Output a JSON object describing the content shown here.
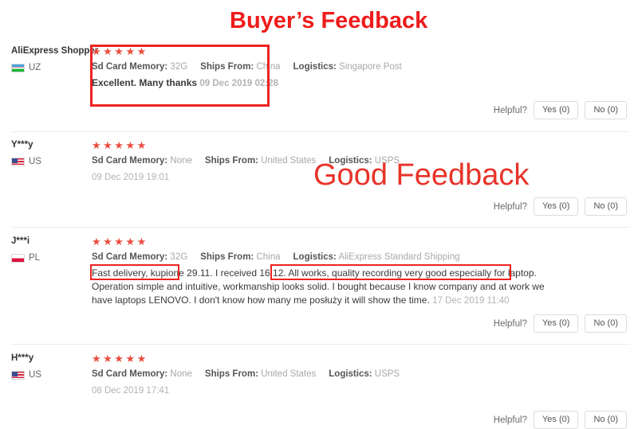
{
  "annotations": {
    "title": "Buyer’s Feedback",
    "subtitle": "Good Feedback",
    "title_color": "#ef1b1b",
    "subtitle_color": "#e8332a",
    "highlight_color": "#ee2222"
  },
  "labels": {
    "sd_card_memory": "Sd Card Memory:",
    "ships_from": "Ships From:",
    "logistics": "Logistics:",
    "helpful": "Helpful?",
    "yes_button": "Yes (0)",
    "no_button": "No (0)",
    "stars": "★★★★★"
  },
  "reviews": [
    {
      "name": "AliExpress Shopper",
      "country_code": "UZ",
      "flag": "flag-uz",
      "rating": 5,
      "sd_card_memory": "32G",
      "ships_from": "China",
      "logistics": "Singapore Post",
      "comment": "Excellent. Many thanks",
      "date": "09 Dec 2019 02:28",
      "helpful_label": "Helpful?",
      "yes": "Yes (0)",
      "no": "No (0)"
    },
    {
      "name": "Y***y",
      "country_code": "US",
      "flag": "flag-us",
      "rating": 5,
      "sd_card_memory": "None",
      "ships_from": "United States",
      "logistics": "USPS",
      "comment": "",
      "date": "09 Dec 2019 19:01",
      "helpful_label": "Helpful?",
      "yes": "Yes (0)",
      "no": "No (0)"
    },
    {
      "name": "J***i",
      "country_code": "PL",
      "flag": "flag-pl",
      "rating": 5,
      "sd_card_memory": "32G",
      "ships_from": "China",
      "logistics": "AliExpress Standard Shipping",
      "comment": "Fast delivery, kupione 29.11. I received 16.12. All works, quality recording very good especially for laptop. Operation simple and intuitive, workmanship looks solid. I bought because I know company and at work we have laptops LENOVO. I don't know how many me posłuży it will show the time.",
      "date": "17 Dec 2019 11:40",
      "helpful_label": "Helpful?",
      "yes": "Yes (0)",
      "no": "No (0)"
    },
    {
      "name": "H***y",
      "country_code": "US",
      "flag": "flag-us",
      "rating": 5,
      "sd_card_memory": "None",
      "ships_from": "United States",
      "logistics": "USPS",
      "comment": "",
      "date": "08 Dec 2019 17:41",
      "helpful_label": "Helpful?",
      "yes": "Yes (0)",
      "no": "No (0)"
    }
  ]
}
